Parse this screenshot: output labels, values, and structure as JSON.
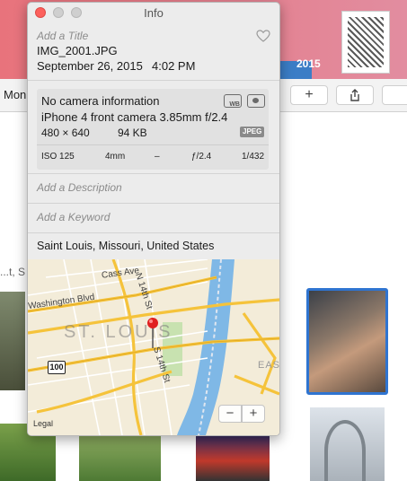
{
  "background": {
    "banner_year": "2015",
    "toolbar_label": "Mon",
    "toolbar_add": "+",
    "breadcrumb": "...t, S"
  },
  "info": {
    "window_title": "Info",
    "title_placeholder": "Add a Title",
    "filename": "IMG_2001.JPG",
    "date": "September 26, 2015",
    "time": "4:02 PM",
    "camera": {
      "no_camera": "No camera information",
      "model": "iPhone 4 front camera 3.85mm f/2.4",
      "dimensions": "480 × 640",
      "size": "94 KB",
      "format": "JPEG",
      "wb_label": "WB"
    },
    "exif": {
      "iso": "ISO 125",
      "focal": "4mm",
      "exposure": "–",
      "aperture": "ƒ/2.4",
      "shutter": "1/432"
    },
    "description_placeholder": "Add a Description",
    "keyword_placeholder": "Add a Keyword",
    "location": "Saint Louis, Missouri, United States"
  },
  "map": {
    "city_label": "ST. LOUIS",
    "streets": [
      "Cass Ave",
      "N 14th St",
      "Washington Blvd",
      "S 14th St"
    ],
    "route_shield": "100",
    "east_fragment": "EAS",
    "legal": "Legal",
    "zoom_out": "−",
    "zoom_in": "+"
  },
  "colors": {
    "accent": "#2f74d0",
    "close": "#fc605c",
    "pin": "#e02020",
    "river": "#7fb8e6",
    "highway": "#f5c33b"
  }
}
